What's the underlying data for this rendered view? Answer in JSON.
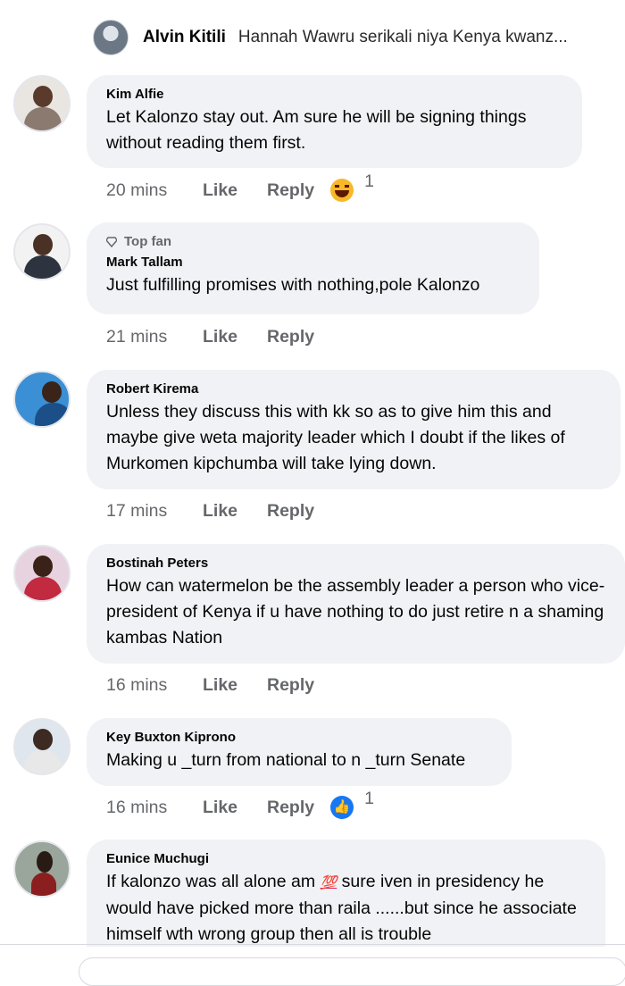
{
  "reply_preview": {
    "name": "Alvin Kitili",
    "text": "Hannah Wawru serikali niya Kenya kwanz..."
  },
  "actions": {
    "like": "Like",
    "reply": "Reply"
  },
  "comments": [
    {
      "name": "Kim Alfie",
      "text": "Let Kalonzo stay out. Am sure he will be signing things without reading them first.",
      "time": "20 mins",
      "reaction": {
        "icon": "haha-emoji-icon",
        "count": "1"
      }
    },
    {
      "badge": "Top fan",
      "name": "Mark Tallam",
      "text": "Just fulfilling promises with nothing,pole Kalonzo",
      "time": "21 mins"
    },
    {
      "name": "Robert Kirema",
      "text": "Unless they discuss this with kk so as to give him this and maybe give weta majority leader which I doubt if the likes of Murkomen kipchumba will take lying down.",
      "time": "17 mins"
    },
    {
      "name": "Bostinah Peters",
      "text": "How can watermelon be the assembly leader a person who vice-president of Kenya if u have nothing to do just retire n a shaming kambas Nation",
      "time": "16 mins"
    },
    {
      "name": "Key Buxton Kiprono",
      "text": "Making u _turn from national to n _turn Senate",
      "time": "16 mins",
      "reaction": {
        "icon": "like-reaction-icon",
        "count": "1"
      }
    },
    {
      "name": "Eunice Muchugi",
      "text_before": "If kalonzo was all alone  am ",
      "emoji": "💯",
      "text_after": " sure iven in presidency he would have picked more than raila ......but since he associate himself wth wrong group then all is trouble"
    }
  ],
  "colors": {
    "bubble_bg": "#f0f2f5",
    "secondary_text": "#65676b",
    "primary_text": "#050505",
    "haha_yellow": "#f7b928",
    "like_blue": "#1877f2"
  }
}
